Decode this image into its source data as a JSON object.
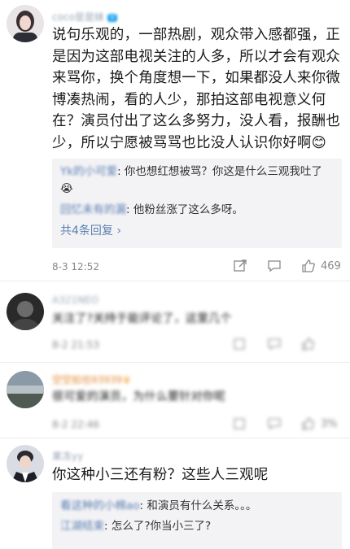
{
  "comments": [
    {
      "name": "coco是是妹",
      "badge": "V",
      "text": "说句乐观的，一部热剧，观众带入感都强，正是因为这部电视关注的人多，所以才会有观众来骂你，换个角度想一下，如果都没人来你微博凑热闹，看的人少，那拍这部电视意义何在？演员付出了这么多努力，没人看，报酬也少，所以宁愿被骂骂也比没人认识你好啊😊",
      "replies": [
        {
          "user": "Yk的小可爱",
          "text": "你也想红想被骂？你这是什么三观我吐了😭"
        },
        {
          "user": "回忆未有的漏",
          "text": "他粉丝涨了这么多呀。"
        }
      ],
      "more": "共4条回复 ›",
      "time": "8-3 12:52",
      "likes": "469"
    },
    {
      "name": "A321NEO",
      "text": "关注了?关持于能评论了，这里几个",
      "time": "8-2 21:53"
    },
    {
      "name": "空空如也93939",
      "text": "很可爱的演员，为什么要针对你呢",
      "time": "8-2 22:46",
      "likes": "3%"
    },
    {
      "name": "果冻yy",
      "text": "你这种小三还有粉？这些人三观呢",
      "replies": [
        {
          "user": "看这种的小棉ao",
          "text": "和演员有什么关系。。。"
        },
        {
          "user": "江湖结束",
          "text": "怎么了?你当小三了?"
        }
      ]
    }
  ],
  "colors": {
    "link": "#5b7fb3",
    "reply_bg": "#f3f3f5",
    "text": "#1a1a1a",
    "meta": "#888888"
  }
}
